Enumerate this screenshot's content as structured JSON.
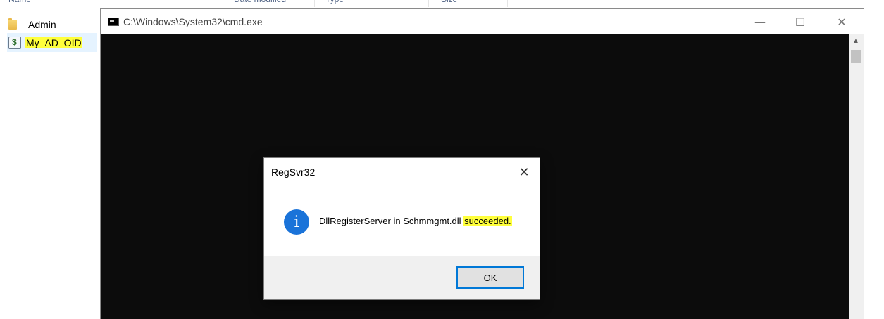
{
  "explorer": {
    "columns": [
      {
        "label": "Name"
      },
      {
        "label": "Date modified"
      },
      {
        "label": "Type"
      },
      {
        "label": "Size"
      }
    ],
    "files": [
      {
        "name": "Admin",
        "icon": "folder-icon"
      },
      {
        "name": "My_AD_OID",
        "icon": "script-file-icon",
        "highlighted": true
      }
    ],
    "highlight_color": "#ffff3b"
  },
  "cmd_window": {
    "title": "C:\\Windows\\System32\\cmd.exe",
    "controls": {
      "minimize": "—",
      "maximize": "☐",
      "close": "✕"
    },
    "background": "#0c0c0c"
  },
  "dialog": {
    "title": "RegSvr32",
    "close_glyph": "✕",
    "message_prefix": "DllRegisterServer in Schmmgmt.dll ",
    "message_highlight": "succeeded.",
    "icon": "info-icon",
    "icon_glyph": "i",
    "ok_label": "OK",
    "accent": "#0078d7"
  }
}
